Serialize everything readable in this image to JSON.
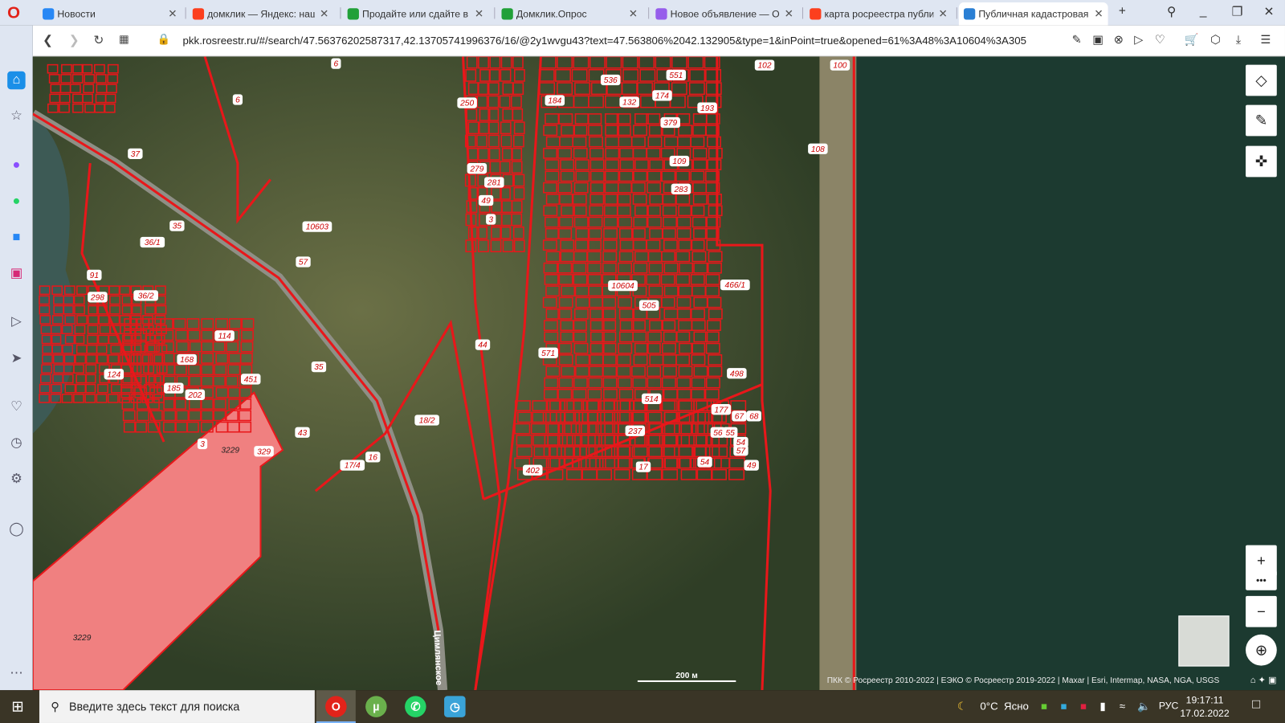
{
  "browser": {
    "tabs": [
      {
        "label": "Новости",
        "icon": "vk-icon",
        "color": "#2787f5"
      },
      {
        "label": "домклик — Яндекс: нашлось",
        "icon": "yandex-icon",
        "color": "#fc3f1d"
      },
      {
        "label": "Продайте или сдайте в аренду",
        "icon": "domclick-icon",
        "color": "#21a038"
      },
      {
        "label": "Домклик.Опрос",
        "icon": "survey-icon",
        "color": "#21a038"
      },
      {
        "label": "Новое объявление — Объявления",
        "icon": "avito-icon",
        "color": "#965eeb"
      },
      {
        "label": "карта росреестра публичная",
        "icon": "yandex-icon",
        "color": "#fc3f1d"
      },
      {
        "label": "Публичная кадастровая карта",
        "icon": "rosreestr-icon",
        "color": "#2a7fd4",
        "active": true
      }
    ],
    "url_host": "pkk.rosreestr.ru",
    "url_rest": "/#/search/47.56376202587317,42.13705741996376/16/@2y1wvgu43?text=47.563806%2042.132905&type=1&inPoint=true&opened=61%3A48%3A10604%3A305"
  },
  "map": {
    "labels": [
      "6",
      "6",
      "102",
      "536",
      "551",
      "250",
      "184",
      "132",
      "174",
      "193",
      "379",
      "37",
      "279",
      "281",
      "109",
      "283",
      "35",
      "10603",
      "49",
      "3",
      "36/1",
      "57",
      "91",
      "10604",
      "466/1",
      "298",
      "36/2",
      "505",
      "114",
      "44",
      "571",
      "168",
      "124",
      "35",
      "451",
      "498",
      "185",
      "202",
      "514",
      "177",
      "67",
      "68",
      "18/2",
      "43",
      "3",
      "3229",
      "329",
      "56",
      "55",
      "237",
      "16",
      "17/4",
      "54",
      "54",
      "57",
      "402",
      "17",
      "49",
      "3229",
      "108",
      "100"
    ],
    "road_label": "Цимлянское",
    "scale_label": "200 м",
    "attribution": "ПКК © Росреестр 2010-2022 | ЕЭКО © Росреестр 2019-2022 | Maxar | Esri, Intermap, NASA, NGA, USGS",
    "parcel_color": "#e8171a",
    "selected_fill": "#f08080"
  },
  "taskbar": {
    "search_placeholder": "Введите здесь текст для поиска",
    "weather_temp": "0°C",
    "weather_text": "Ясно",
    "language": "РУС",
    "time": "19:17:11",
    "date": "17.02.2022"
  }
}
